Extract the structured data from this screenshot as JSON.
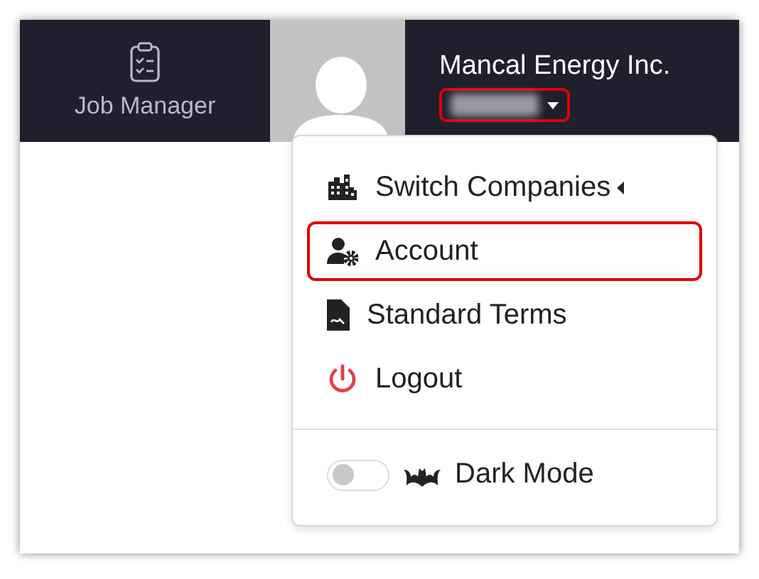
{
  "nav_item": {
    "label": "Job Manager"
  },
  "company": {
    "name": "Mancal Energy Inc."
  },
  "user_menu_toggle": {
    "highlighted": true
  },
  "menu": {
    "items": [
      {
        "label": "Switch Companies",
        "has_submenu": true,
        "highlighted": false
      },
      {
        "label": "Account",
        "has_submenu": false,
        "highlighted": true
      },
      {
        "label": "Standard Terms",
        "has_submenu": false,
        "highlighted": false
      },
      {
        "label": "Logout",
        "has_submenu": false,
        "highlighted": false
      }
    ],
    "dark_mode": {
      "label": "Dark Mode",
      "on": false
    }
  }
}
